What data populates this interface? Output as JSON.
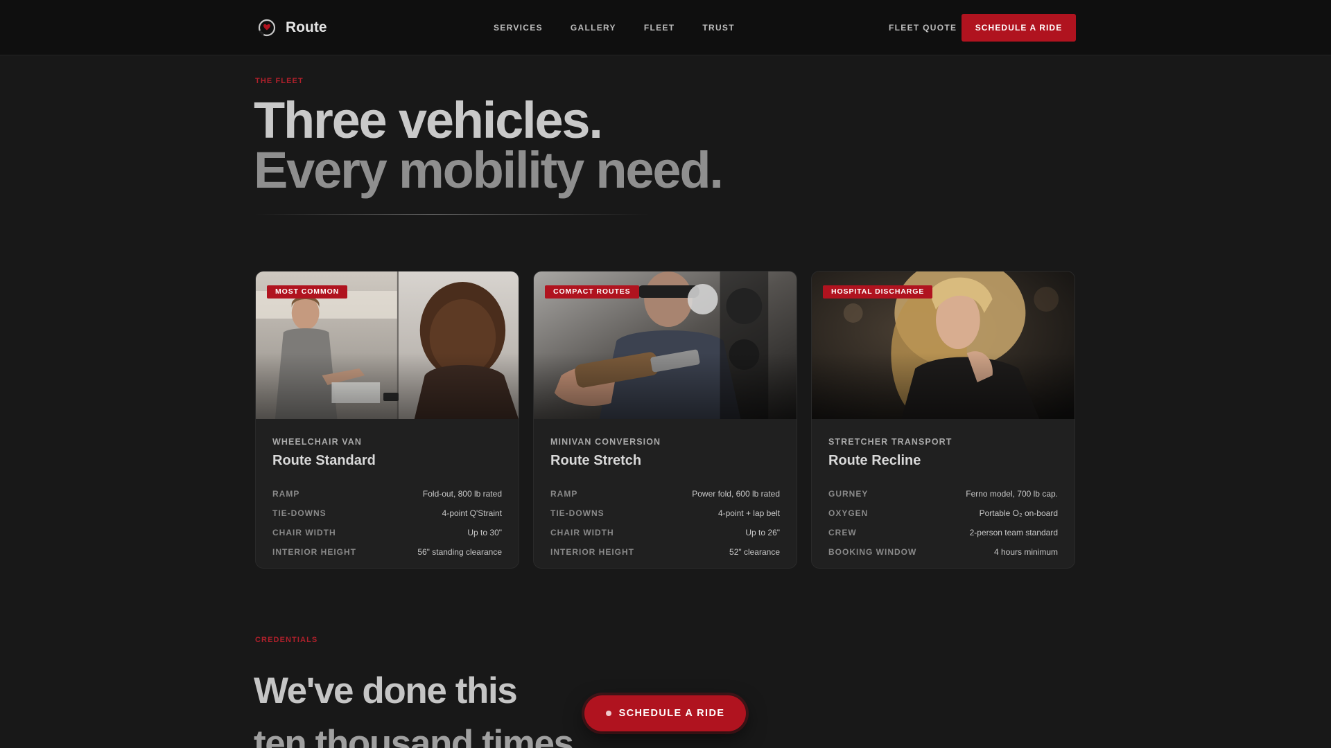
{
  "nav": {
    "brand": "Route",
    "links": [
      "SERVICES",
      "GALLERY",
      "FLEET",
      "TRUST"
    ],
    "fleet_quote": "FLEET QUOTE",
    "cta": "SCHEDULE A RIDE"
  },
  "hero": {
    "eyebrow": "THE FLEET",
    "title_line1": "Three vehicles.",
    "title_line2": "Every mobility need."
  },
  "cards": [
    {
      "badge": "MOST COMMON",
      "kicker": "WHEELCHAIR VAN",
      "title": "Route Standard",
      "specs": [
        {
          "key": "RAMP",
          "value": "Fold-out, 800 lb rated"
        },
        {
          "key": "TIE-DOWNS",
          "value": "4-point Q'Straint"
        },
        {
          "key": "CHAIR WIDTH",
          "value": "Up to 30\""
        },
        {
          "key": "INTERIOR HEIGHT",
          "value": "56\" standing clearance"
        }
      ]
    },
    {
      "badge": "COMPACT ROUTES",
      "kicker": "MINIVAN CONVERSION",
      "title": "Route Stretch",
      "specs": [
        {
          "key": "RAMP",
          "value": "Power fold, 600 lb rated"
        },
        {
          "key": "TIE-DOWNS",
          "value": "4-point + lap belt"
        },
        {
          "key": "CHAIR WIDTH",
          "value": "Up to 26\""
        },
        {
          "key": "INTERIOR HEIGHT",
          "value": "52\" clearance"
        }
      ]
    },
    {
      "badge": "HOSPITAL DISCHARGE",
      "kicker": "STRETCHER TRANSPORT",
      "title": "Route Recline",
      "specs": [
        {
          "key": "GURNEY",
          "value": "Ferno model, 700 lb cap."
        },
        {
          "key": "OXYGEN",
          "value": "Portable O₂ on-board"
        },
        {
          "key": "CREW",
          "value": "2-person team standard"
        },
        {
          "key": "BOOKING WINDOW",
          "value": "4 hours minimum"
        }
      ]
    }
  ],
  "credentials": {
    "eyebrow": "CREDENTIALS",
    "title_line1": "We've done this",
    "title_line2": "ten thousand times."
  },
  "floating_cta": "SCHEDULE A RIDE",
  "colors": {
    "accent": "#b0131f",
    "background": "#181818",
    "nav_background": "#0f0f0f",
    "card_background": "#202020"
  },
  "icons": {
    "brand": "route-logo-icon",
    "cta_dot": "dot-icon"
  }
}
